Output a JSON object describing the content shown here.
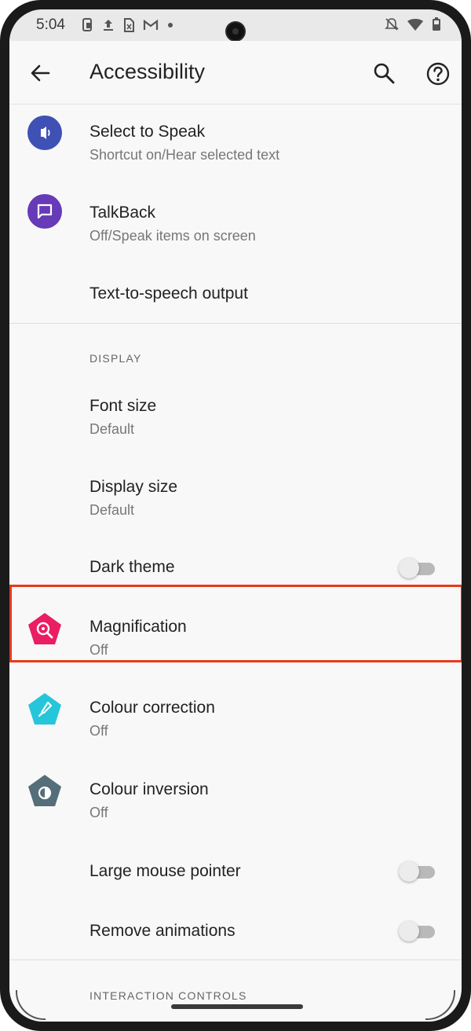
{
  "status_bar": {
    "time": "5:04",
    "left_icons": [
      "notification-screenshot-icon",
      "upload-icon",
      "sim-card-icon",
      "gmail-icon",
      "dot-icon"
    ],
    "right_icons": [
      "do-not-disturb-icon",
      "wifi-icon",
      "battery-icon"
    ]
  },
  "app_bar": {
    "title": "Accessibility",
    "icons": [
      "back-arrow-icon",
      "search-icon",
      "help-icon"
    ]
  },
  "items": {
    "select_to_speak": {
      "title": "Select to Speak",
      "subtitle": "Shortcut on/Hear selected text",
      "icon": "select-to-speak-icon",
      "icon_color": "#3f51b5"
    },
    "talkback": {
      "title": "TalkBack",
      "subtitle": "Off/Speak items on screen",
      "icon": "talkback-icon",
      "icon_color": "#673ab7"
    },
    "tts": {
      "title": "Text-to-speech output"
    },
    "display_header": "DISPLAY",
    "font_size": {
      "title": "Font size",
      "subtitle": "Default"
    },
    "display_size": {
      "title": "Display size",
      "subtitle": "Default"
    },
    "dark_theme": {
      "title": "Dark theme",
      "enabled": false
    },
    "magnification": {
      "title": "Magnification",
      "subtitle": "Off",
      "icon": "magnification-icon",
      "icon_color": "#e91e63"
    },
    "colour_correction": {
      "title": "Colour correction",
      "subtitle": "Off",
      "icon": "colour-correction-icon",
      "icon_color": "#26c6da"
    },
    "colour_inversion": {
      "title": "Colour inversion",
      "subtitle": "Off",
      "icon": "colour-inversion-icon",
      "icon_color": "#546e7a"
    },
    "large_mouse_pointer": {
      "title": "Large mouse pointer",
      "enabled": false
    },
    "remove_animations": {
      "title": "Remove animations",
      "enabled": false
    },
    "interaction_header": "INTERACTION CONTROLS"
  },
  "highlight_color": "#e8391a"
}
